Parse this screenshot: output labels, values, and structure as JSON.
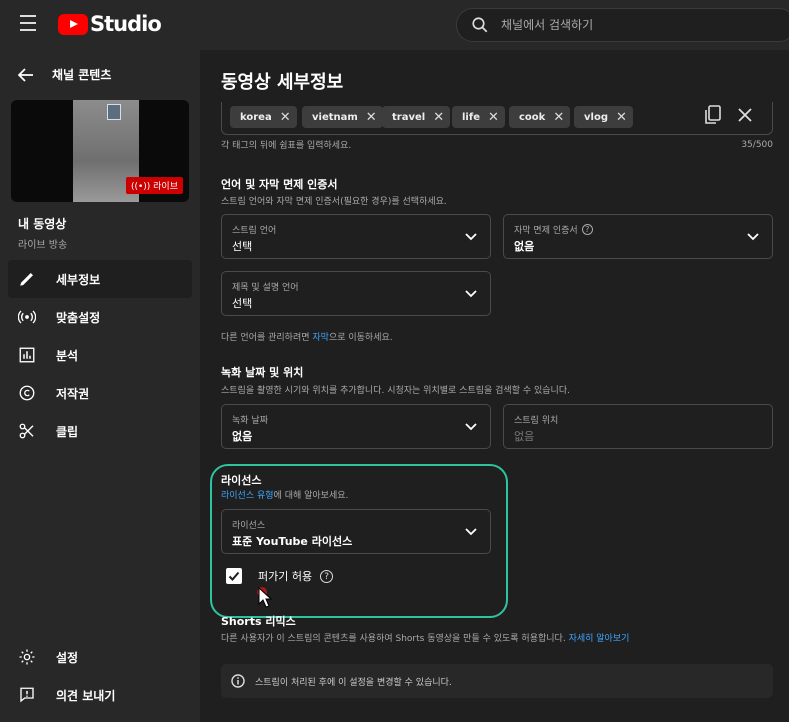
{
  "header": {
    "logo_text": "Studio",
    "search_placeholder": "채널에서 검색하기"
  },
  "sidebar": {
    "back_label": "채널 콘텐츠",
    "thumbnail_badge": "((•)) 라이브",
    "video_title": "내 동영상",
    "video_subtitle": "라이브 방송",
    "nav": [
      {
        "label": "세부정보",
        "icon": "pencil-icon",
        "active": true
      },
      {
        "label": "맞춤설정",
        "icon": "broadcast-icon"
      },
      {
        "label": "분석",
        "icon": "analytics-icon"
      },
      {
        "label": "저작권",
        "icon": "copyright-icon"
      },
      {
        "label": "클립",
        "icon": "scissors-icon"
      }
    ],
    "bottom_nav": [
      {
        "label": "설정",
        "icon": "gear-icon"
      },
      {
        "label": "의견 보내기",
        "icon": "feedback-icon"
      }
    ]
  },
  "main": {
    "title": "동영상 세부정보",
    "tags": [
      "korea",
      "vietnam",
      "travel",
      "life",
      "cook",
      "vlog"
    ],
    "tag_hint": "각 태그의 뒤에 쉼표를 입력하세요.",
    "tag_count": "35/500",
    "language_section": {
      "title": "언어 및 자막 면제 인증서",
      "desc": "스트림 언어와 자막 면제 인증서(필요한 경우)를 선택하세요.",
      "stream_language": {
        "label": "스트림 언어",
        "value": "선택"
      },
      "caption_cert": {
        "label": "자막 면제 인증서",
        "value": "없음"
      },
      "title_language": {
        "label": "제목 및 설명 언어",
        "value": "선택"
      },
      "manage_text_before": "다른 언어를 관리하려면 ",
      "manage_link": "자막",
      "manage_text_after": "으로 이동하세요."
    },
    "recording_section": {
      "title": "녹화 날짜 및 위치",
      "desc": "스트림을 촬영한 시기와 위치를 추가합니다. 시청자는 위치별로 스트림을 검색할 수 있습니다.",
      "date": {
        "label": "녹화 날짜",
        "value": "없음"
      },
      "location": {
        "label": "스트림 위치",
        "placeholder": "없음"
      }
    },
    "license_section": {
      "title": "라이선스",
      "desc_link": "라이선스 유형",
      "desc_after": "에 대해 알아보세요.",
      "license": {
        "label": "라이선스",
        "value": "표준 YouTube 라이선스"
      },
      "embed_label": "퍼가기 허용",
      "embed_checked": true
    },
    "shorts_section": {
      "title": "Shorts 리믹스",
      "desc": "다른 사용자가 이 스트림의 콘텐츠를 사용하여 Shorts 동영상을 만들 수 있도록 허용합니다. ",
      "desc_link": "자세히 알아보기"
    },
    "notice": "스트림이 처리된 후에 이 설정을 변경할 수 있습니다."
  },
  "colors": {
    "accent_link": "#3ea6ff",
    "highlight": "#2ec4a0",
    "brand_red": "#ff0000"
  }
}
